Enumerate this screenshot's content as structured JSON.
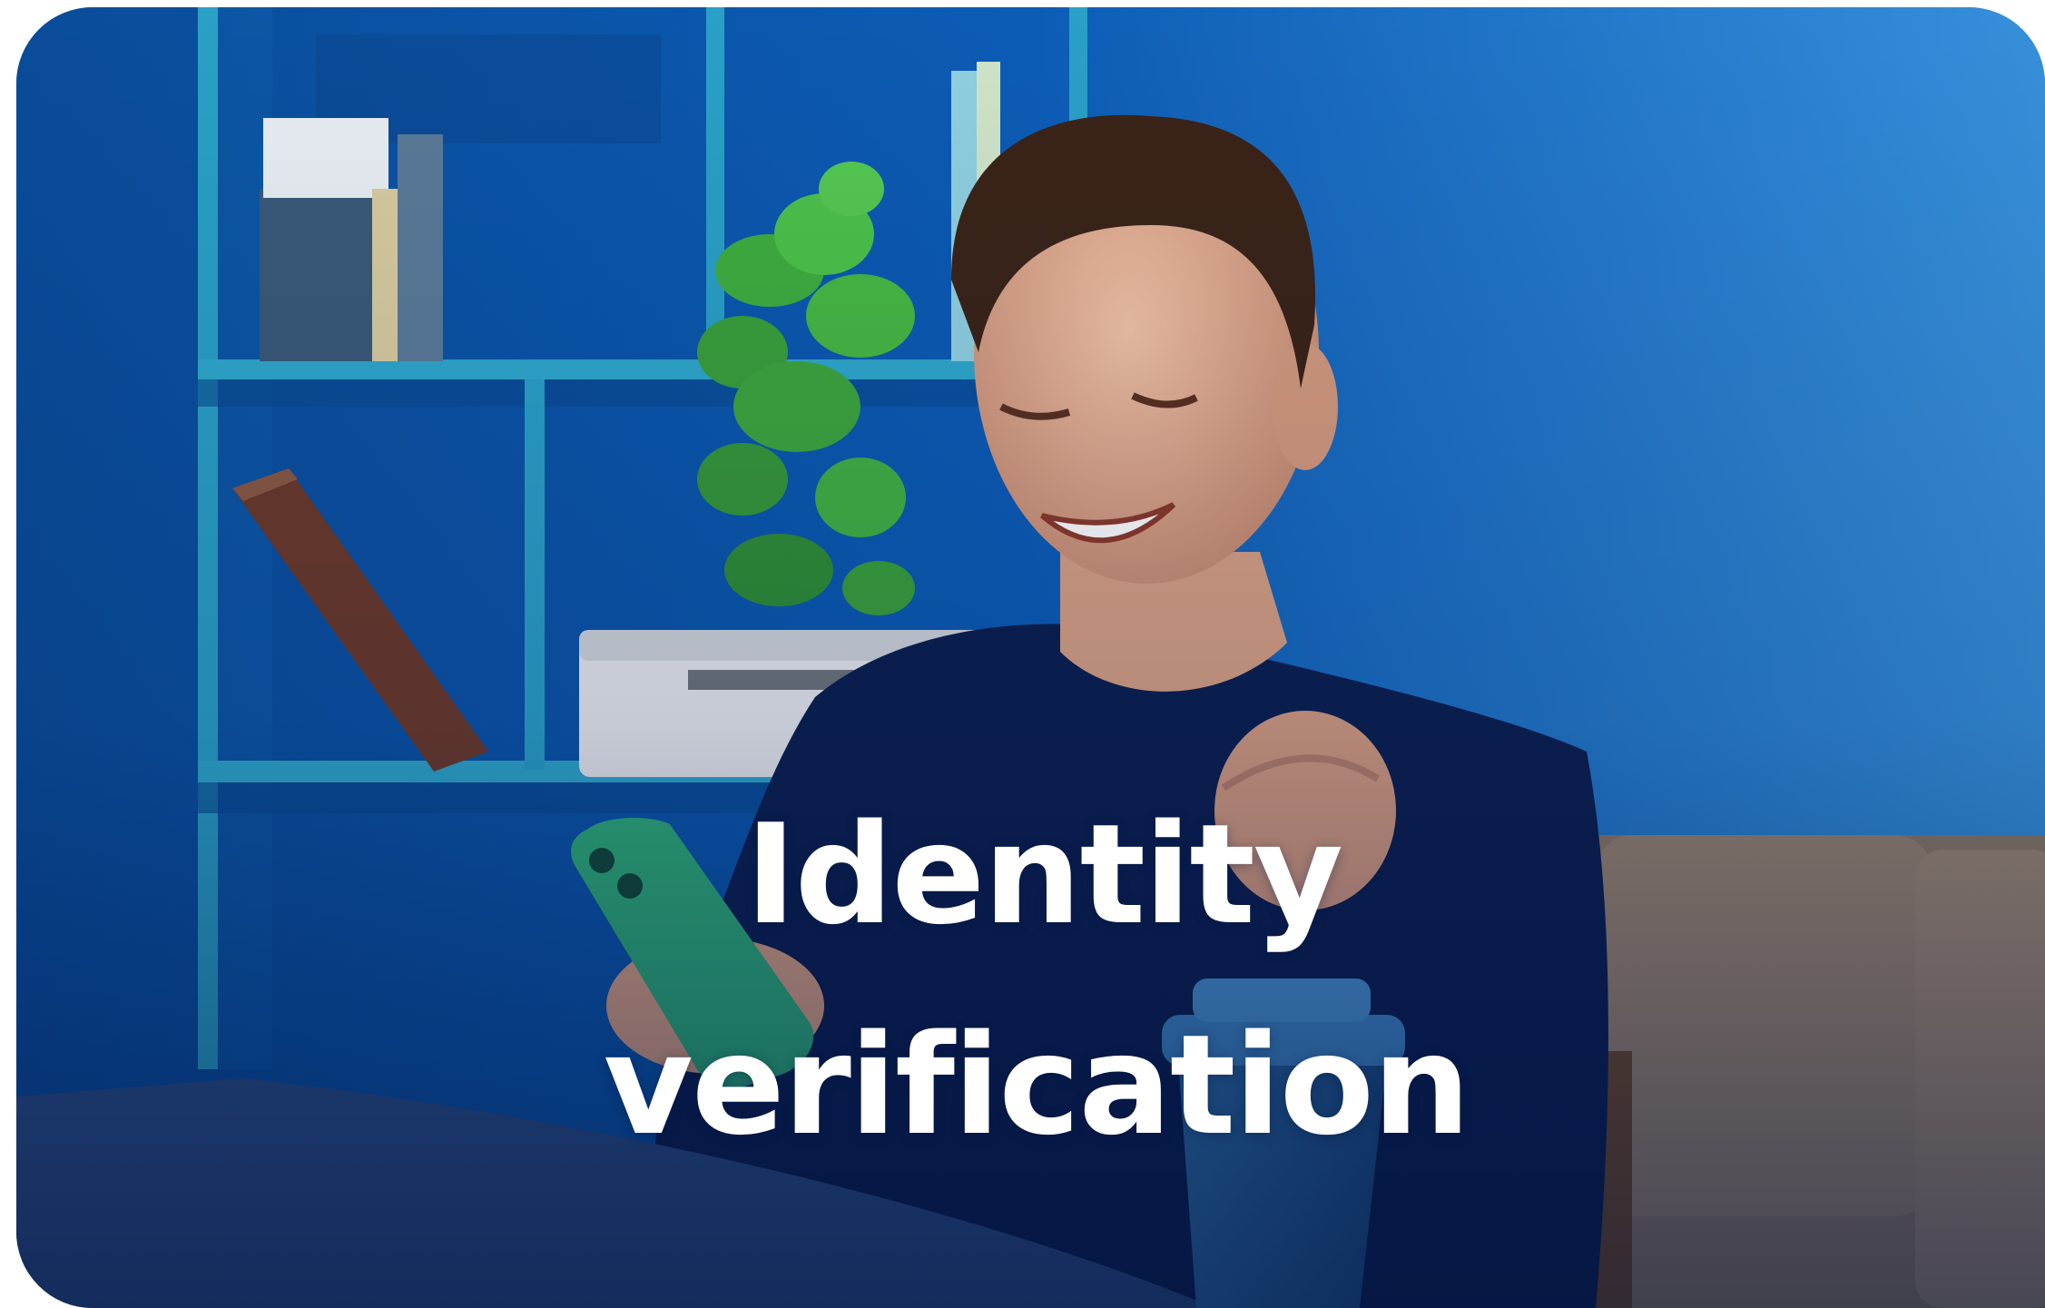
{
  "card": {
    "image": "smiling-man-holding-phone-in-blue-room",
    "colors": {
      "wall": "#0b5cb4",
      "shelf": "#2aa4c8",
      "sweater": "#0b1f4a",
      "phone": "#2fae78",
      "sofa": "#8a7560",
      "table": "#2c4f86",
      "title_text": "#ffffff"
    },
    "title_lines": [
      "Identity",
      "verification"
    ]
  }
}
